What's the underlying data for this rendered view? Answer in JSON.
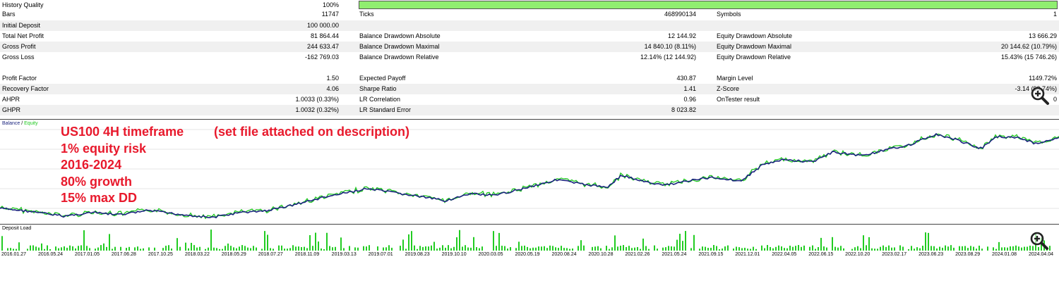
{
  "stats": {
    "row1": {
      "l1": "History Quality",
      "v1": "100%"
    },
    "row2": {
      "l1": "Bars",
      "v1": "11747",
      "l2": "Ticks",
      "v2": "468990134",
      "l3": "Symbols",
      "v3": "1"
    },
    "row3": {
      "l1": "Initial Deposit",
      "v1": "100 000.00"
    },
    "row4": {
      "l1": "Total Net Profit",
      "v1": "81 864.44",
      "l2": "Balance Drawdown Absolute",
      "v2": "12 144.92",
      "l3": "Equity Drawdown Absolute",
      "v3": "13 666.29"
    },
    "row5": {
      "l1": "Gross Profit",
      "v1": "244 633.47",
      "l2": "Balance Drawdown Maximal",
      "v2": "14 840.10 (8.11%)",
      "l3": "Equity Drawdown Maximal",
      "v3": "20 144.62 (10.79%)"
    },
    "row6": {
      "l1": "Gross Loss",
      "v1": "-162 769.03",
      "l2": "Balance Drawdown Relative",
      "v2": "12.14% (12 144.92)",
      "l3": "Equity Drawdown Relative",
      "v3": "15.43% (15 746.26)"
    },
    "row7": {
      "l1": "Profit Factor",
      "v1": "1.50",
      "l2": "Expected Payoff",
      "v2": "430.87",
      "l3": "Margin Level",
      "v3": "1149.72%"
    },
    "row8": {
      "l1": "Recovery Factor",
      "v1": "4.06",
      "l2": "Sharpe Ratio",
      "v2": "1.41",
      "l3": "Z-Score",
      "v3": "-3.14 (99.74%)"
    },
    "row9": {
      "l1": "AHPR",
      "v1": "1.0033 (0.33%)",
      "l2": "LR Correlation",
      "v2": "0.96",
      "l3": "OnTester result",
      "v3": "0"
    },
    "row10": {
      "l1": "GHPR",
      "v1": "1.0032 (0.32%)",
      "l2": "LR Standard Error",
      "v2": "8 023.82"
    }
  },
  "history_quality_fill": 1.0,
  "chart": {
    "legend_balance": "Balance",
    "legend_sep": " / ",
    "legend_equity": "Equity",
    "balance_color": "#1a237e",
    "equity_color": "#1ec81e"
  },
  "overlay": {
    "line1": "US100 4H timeframe",
    "line2": "1% equity risk",
    "line3": "2016-2024",
    "line4": "80% growth",
    "line5": "15% max DD",
    "note": "(set file attached on description)",
    "color": "#e8192c"
  },
  "deposit_load": {
    "label": "Deposit Load",
    "color": "#22cc22"
  },
  "x_ticks": [
    "2016.01.27",
    "2016.05.24",
    "2017.01.05",
    "2017.06.28",
    "2017.10.25",
    "2018.03.22",
    "2018.05.29",
    "2018.07.27",
    "2018.11.09",
    "2019.03.13",
    "2019.07.01",
    "2019.08.23",
    "2019.10.10",
    "2020.03.05",
    "2020.05.19",
    "2020.08.24",
    "2020.10.28",
    "2021.02.26",
    "2021.05.24",
    "2021.09.15",
    "2021.12.01",
    "2022.04.05",
    "2022.06.15",
    "2022.10.20",
    "2023.02.17",
    "2023.06.23",
    "2023.08.29",
    "2024.01.08",
    "2024.04.04"
  ],
  "icons": {
    "zoom": "zoom-in-icon"
  }
}
